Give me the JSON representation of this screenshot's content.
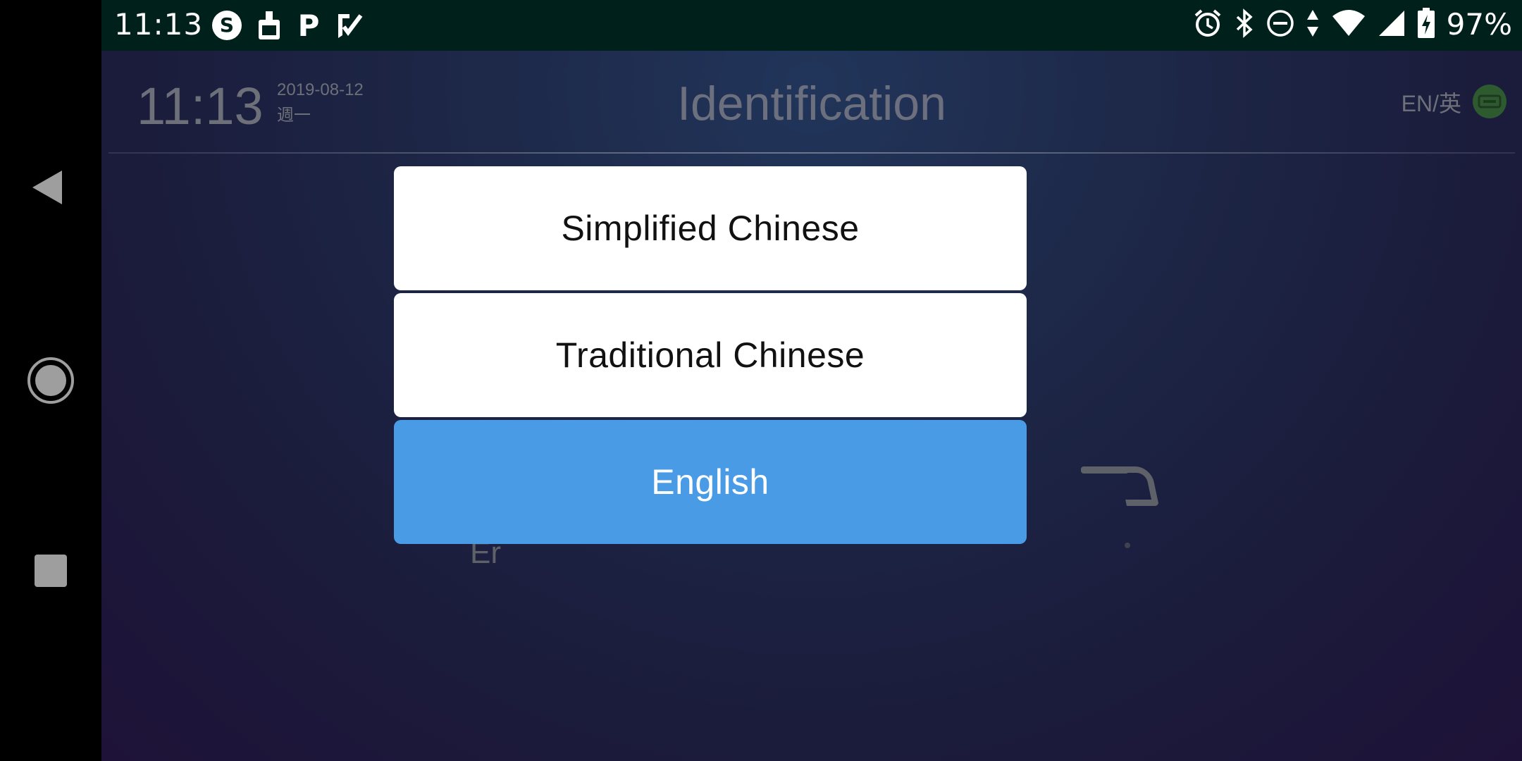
{
  "statusbar": {
    "time": "11:13",
    "battery_percent": "97%",
    "left_icons": [
      "s-app-icon",
      "cleaner-icon",
      "p-app-icon",
      "task-check-icon"
    ],
    "right_icons": [
      "alarm-icon",
      "bluetooth-icon",
      "do-not-disturb-icon",
      "data-arrows-icon",
      "wifi-icon",
      "signal-icon",
      "battery-charging-icon"
    ]
  },
  "header": {
    "time": "11:13",
    "date": "2019-08-12",
    "weekday": "週一",
    "title": "Identification",
    "language": "EN/英"
  },
  "background": {
    "partial_text": "Er"
  },
  "dialog": {
    "options": [
      {
        "label": "Simplified Chinese",
        "selected": false
      },
      {
        "label": "Traditional Chinese",
        "selected": false
      },
      {
        "label": "English",
        "selected": true
      }
    ]
  },
  "colors": {
    "statusbar": "#00201b",
    "selected_option": "#4a9be6",
    "option": "#ffffff",
    "header_text": "#6d7079"
  }
}
